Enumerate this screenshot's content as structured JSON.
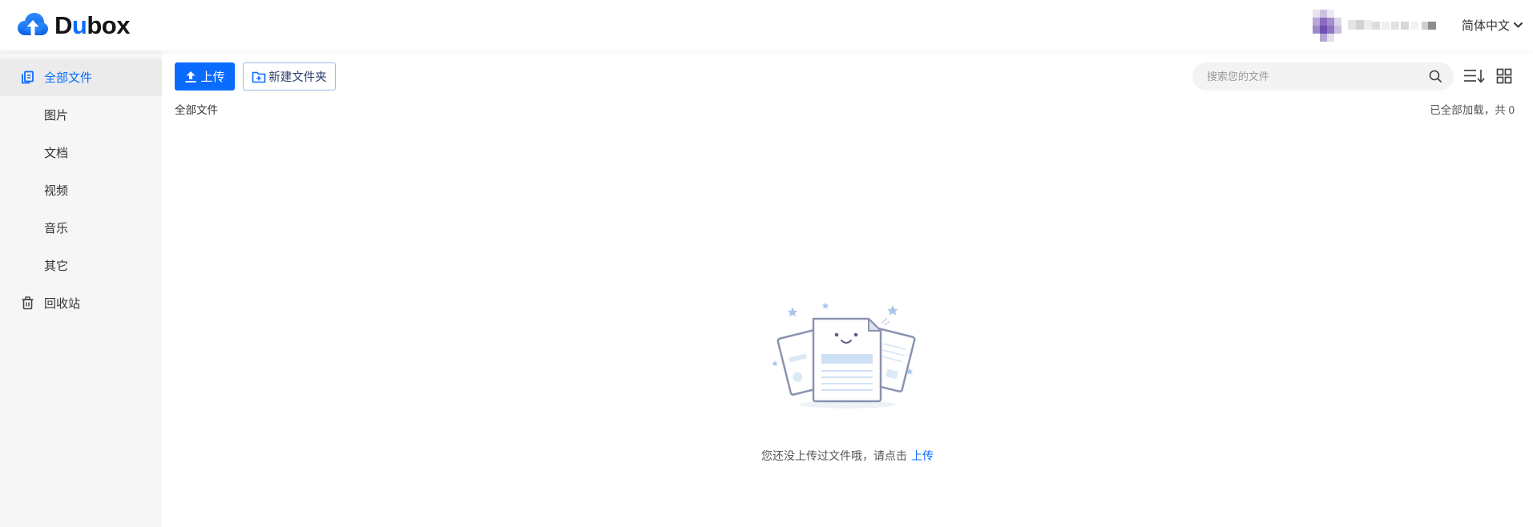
{
  "logo": {
    "parts": [
      "D",
      "u",
      "box"
    ],
    "icon": "cloud-upload-icon"
  },
  "header": {
    "language": "简体中文",
    "language_icon": "chevron-down-icon"
  },
  "sidebar": {
    "items": [
      {
        "label": "全部文件",
        "icon": "files-icon",
        "active": true
      },
      {
        "label": "图片"
      },
      {
        "label": "文档"
      },
      {
        "label": "视频"
      },
      {
        "label": "音乐"
      },
      {
        "label": "其它"
      },
      {
        "label": "回收站",
        "icon": "trash-icon"
      }
    ]
  },
  "toolbar": {
    "upload_label": "上传",
    "upload_icon": "upload-icon",
    "new_folder_label": "新建文件夹",
    "new_folder_icon": "folder-plus-icon",
    "search_placeholder": "搜索您的文件",
    "search_icon": "search-icon",
    "sort_icon": "sort-icon",
    "view_icon": "grid-view-icon"
  },
  "breadcrumb": "全部文件",
  "status": "已全部加载，共 0",
  "empty": {
    "message": "您还没上传过文件哦，请点击",
    "link": "上传",
    "illustration": "empty-documents-illustration"
  },
  "colors": {
    "accent": "#0a6cff",
    "sidebar_bg": "#f6f6f6",
    "active_bg": "#ebebeb",
    "text": "#333333",
    "muted": "#999999"
  }
}
